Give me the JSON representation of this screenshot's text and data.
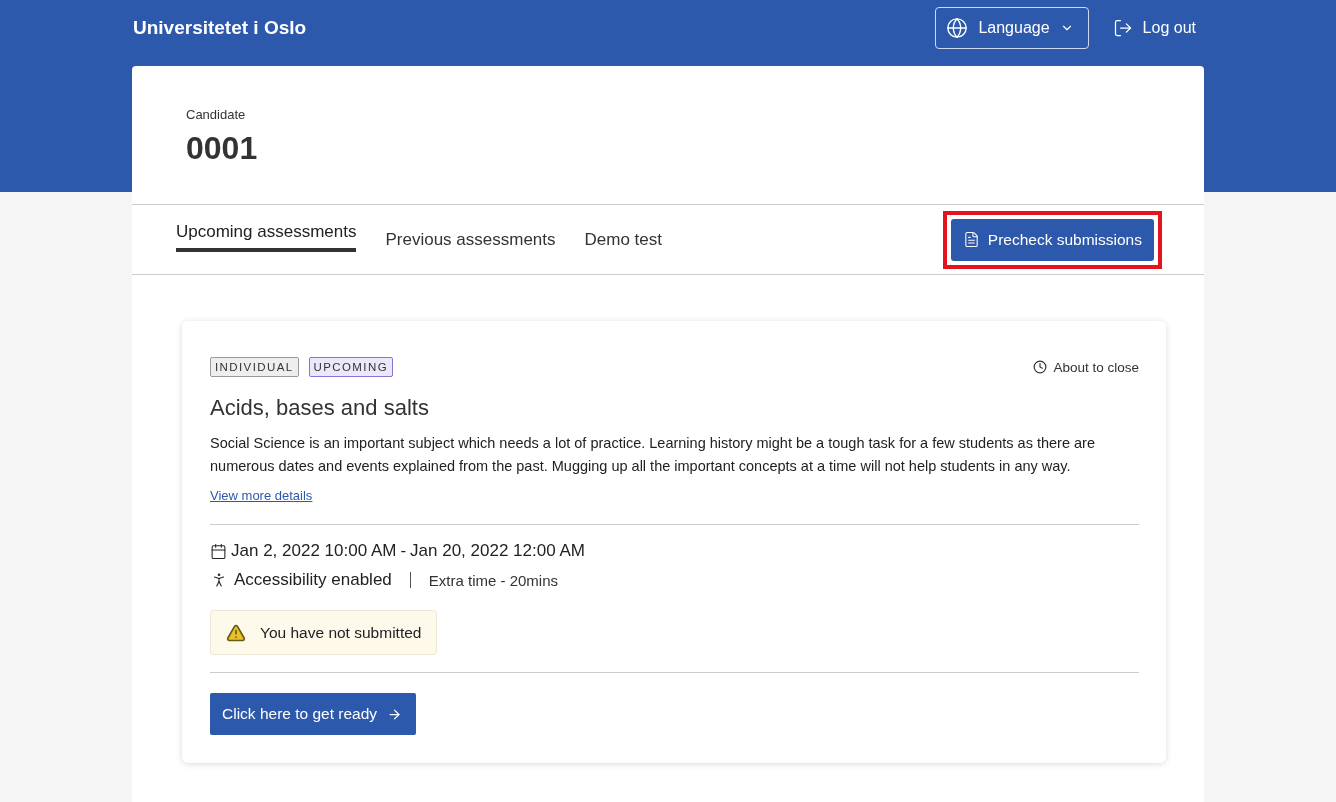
{
  "header": {
    "brand": "Universitetet i Oslo",
    "language_button": "Language",
    "logout": "Log out"
  },
  "candidate": {
    "label": "Candidate",
    "number": "0001"
  },
  "tabs": [
    {
      "label": "Upcoming assessments",
      "selected": true
    },
    {
      "label": "Previous assessments",
      "selected": false
    },
    {
      "label": "Demo test",
      "selected": false
    }
  ],
  "precheck_button": {
    "label": "Precheck submissions",
    "highlighted": true
  },
  "assessment": {
    "tags": [
      {
        "label": "INDIVIDUAL",
        "kind": "neutral"
      },
      {
        "label": "UPCOMING",
        "kind": "status"
      }
    ],
    "status": "About to close",
    "title": "Acids, bases and salts",
    "description": "Social Science is an important subject which needs a lot of practice. Learning history might be a tough task for a few students as there are numerous dates and events explained from the past. Mugging up all the important concepts at a time will not help students in any way.",
    "details_link": "View more details",
    "start": "Jan 2, 2022 10:00 AM",
    "separator": "-",
    "end": "Jan 20, 2022 12:00 AM",
    "accessibility": "Accessibility enabled",
    "extra_time": "Extra time - 20mins",
    "warning": "You have not submitted",
    "action_button": "Click here to get ready"
  }
}
